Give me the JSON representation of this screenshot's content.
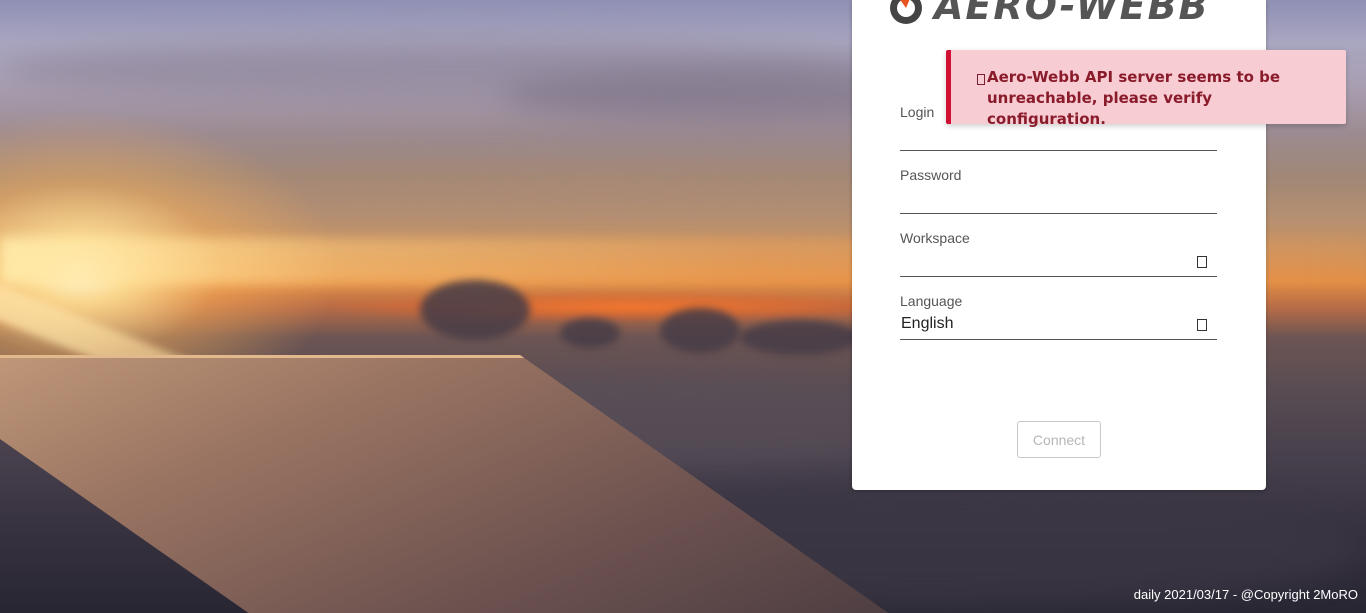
{
  "app": {
    "logo_text": "AERO-WEBB"
  },
  "form": {
    "login_label": "Login",
    "password_label": "Password",
    "workspace_label": "Workspace",
    "language_label": "Language",
    "language_value": "English",
    "connect_label": "Connect"
  },
  "toast": {
    "icon": "warning-icon",
    "message": "Aero-Webb API server seems to be unreachable, please verify configuration.",
    "accent_color": "#d10f33"
  },
  "footer": {
    "text": "daily 2021/03/17 - @Copyright 2MoRO"
  },
  "colors": {
    "logo_accent": "#e8531f",
    "text_dark": "#555555"
  }
}
